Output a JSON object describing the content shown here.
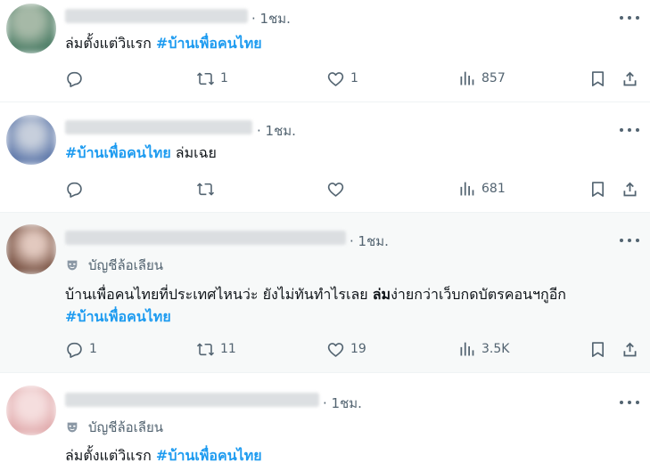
{
  "posts": [
    {
      "time": "· 1ชม.",
      "has_label": false,
      "segments": [
        {
          "text": "ล่มตั้งแต่วิแรก ",
          "style": "normal"
        },
        {
          "text": "#บ้านเพื่อคนไทย",
          "style": "hashtag"
        }
      ],
      "second_line": [],
      "stats": {
        "replies": "",
        "reposts": "1",
        "likes": "1",
        "views": "857"
      },
      "avatar_color": "#5f8a76"
    },
    {
      "time": "· 1ชม.",
      "has_label": false,
      "segments": [
        {
          "text": "#บ้านเพื่อคนไทย",
          "style": "hashtag"
        },
        {
          "text": " ล่มเฉย",
          "style": "normal"
        }
      ],
      "second_line": [],
      "stats": {
        "replies": "",
        "reposts": "",
        "likes": "",
        "views": "681"
      },
      "avatar_color": "#6d86b6"
    },
    {
      "time": "· 1ชม.",
      "has_label": true,
      "label": "บัญชีล้อเลียน",
      "segments": [
        {
          "text": "บ้านเพื่อคนไทยที่ประเทศไหนว่ะ ยังไม่ทันทำไรเลย ",
          "style": "normal"
        },
        {
          "text": "ล่ม",
          "style": "bold"
        },
        {
          "text": "ง่ายกว่าเว็บกดบัตรคอนฯกูอีก",
          "style": "normal"
        }
      ],
      "second_line": [
        {
          "text": "#บ้านเพื่อคนไทย",
          "style": "hashtag"
        }
      ],
      "stats": {
        "replies": "1",
        "reposts": "11",
        "likes": "19",
        "views": "3.5K"
      },
      "avatar_color": "#8c6a5a"
    },
    {
      "time": "· 1ชม.",
      "has_label": true,
      "label": "บัญชีล้อเลียน",
      "segments": [
        {
          "text": "ล่มตั้งแต่วิแรก ",
          "style": "normal"
        },
        {
          "text": "#บ้านเพื่อคนไทย",
          "style": "hashtag"
        }
      ],
      "second_line": [],
      "stats": {
        "replies": "",
        "reposts": "",
        "likes": "",
        "views": ""
      },
      "avatar_color": "#e7b8b8"
    }
  ],
  "colors": {
    "accent": "#1d9bf0",
    "muted": "#536471",
    "text": "#0f1419"
  },
  "icons": [
    "reply-icon",
    "repost-icon",
    "like-icon",
    "views-icon",
    "bookmark-icon",
    "share-icon",
    "more-icon",
    "parody-mask-icon"
  ]
}
